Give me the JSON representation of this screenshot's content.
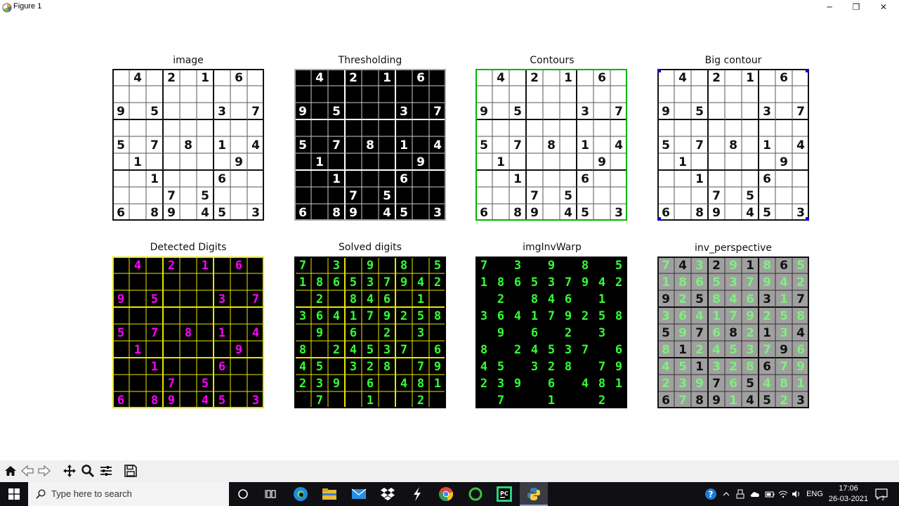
{
  "window": {
    "title": "Figure 1",
    "controls": [
      "─",
      "❐",
      "✕"
    ]
  },
  "panels": [
    {
      "title": "image",
      "style": "white"
    },
    {
      "title": "Thresholding",
      "style": "black"
    },
    {
      "title": "Contours",
      "style": "contour"
    },
    {
      "title": "Big contour",
      "style": "bigcontour"
    },
    {
      "title": "Detected Digits",
      "style": "detected"
    },
    {
      "title": "Solved digits",
      "style": "solved"
    },
    {
      "title": "imgInvWarp",
      "style": "warp"
    },
    {
      "title": "inv_perspective",
      "style": "inv"
    }
  ],
  "puzzle": [
    [
      0,
      4,
      0,
      2,
      0,
      1,
      0,
      6,
      0
    ],
    [
      0,
      0,
      0,
      0,
      0,
      0,
      0,
      0,
      0
    ],
    [
      9,
      0,
      5,
      0,
      0,
      0,
      3,
      0,
      7
    ],
    [
      0,
      0,
      0,
      0,
      0,
      0,
      0,
      0,
      0
    ],
    [
      5,
      0,
      7,
      0,
      8,
      0,
      1,
      0,
      4
    ],
    [
      0,
      1,
      0,
      0,
      0,
      0,
      0,
      9,
      0
    ],
    [
      0,
      0,
      1,
      0,
      0,
      0,
      6,
      0,
      0
    ],
    [
      0,
      0,
      0,
      7,
      0,
      5,
      0,
      0,
      0
    ],
    [
      6,
      0,
      8,
      9,
      0,
      4,
      5,
      0,
      3
    ]
  ],
  "solution": [
    [
      7,
      4,
      3,
      2,
      9,
      1,
      8,
      6,
      5
    ],
    [
      1,
      8,
      6,
      5,
      3,
      7,
      9,
      4,
      2
    ],
    [
      9,
      2,
      5,
      8,
      4,
      6,
      3,
      1,
      7
    ],
    [
      3,
      6,
      4,
      1,
      7,
      9,
      2,
      5,
      8
    ],
    [
      5,
      9,
      7,
      6,
      8,
      2,
      1,
      3,
      4
    ],
    [
      8,
      1,
      2,
      4,
      5,
      3,
      7,
      9,
      6
    ],
    [
      4,
      5,
      1,
      3,
      2,
      8,
      6,
      7,
      9
    ],
    [
      2,
      3,
      9,
      7,
      6,
      5,
      4,
      8,
      1
    ],
    [
      6,
      7,
      8,
      9,
      1,
      4,
      5,
      2,
      3
    ]
  ],
  "colors": {
    "detected_digit": "#ff00ff",
    "grid_yellow": "#e6e600",
    "solved_digit": "#33ff33",
    "contour_green": "#00b400",
    "corner_blue": "#0000cc",
    "inv_bg": "#a0a0a0",
    "inv_digit": "#7ef07e"
  },
  "toolbar": {
    "buttons": [
      "home-icon",
      "back-arrow-icon",
      "forward-arrow-icon",
      "pan-icon",
      "zoom-icon",
      "configure-subplots-icon",
      "save-icon"
    ]
  },
  "taskbar": {
    "search_placeholder": "Type here to search",
    "apps": [
      "cortana-icon",
      "task-view-icon",
      "edge-icon",
      "file-explorer-icon",
      "mail-icon",
      "dropbox-icon",
      "winamp-icon",
      "chrome-icon",
      "green-ring-icon",
      "pycharm-icon",
      "python-icon"
    ],
    "tray": [
      "help-icon",
      "chevron-up-icon",
      "usb-icon",
      "cloud-icon",
      "battery-icon",
      "wifi-icon",
      "volume-icon"
    ],
    "language": "ENG",
    "time": "17:06",
    "date": "26-03-2021",
    "notifications": "2"
  }
}
